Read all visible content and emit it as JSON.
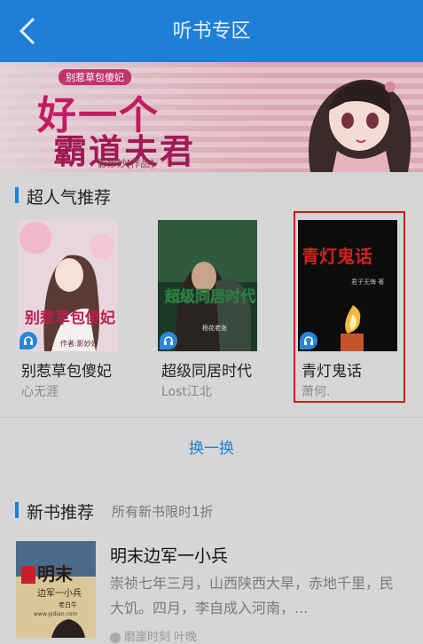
{
  "header": {
    "title": "听书专区",
    "back_icon": "back-arrow-icon"
  },
  "banner": {
    "subtitle": "别惹草包傻妃",
    "title_line1": "好一个",
    "title_line2": "霸道夫君",
    "author": "影妙妙[作品]"
  },
  "popular": {
    "section_title": "超人气推荐",
    "books": [
      {
        "title": "别惹草包傻妃",
        "author": "心无涯",
        "cover_text": "别惹草包傻妃",
        "cover_author": "作者:影妙妙"
      },
      {
        "title": "超级同居时代",
        "author": "Lost江北",
        "cover_text": "超级同居时代",
        "cover_author": "杨花老张"
      },
      {
        "title": "青灯鬼话",
        "author": "萧何.",
        "cover_text": "青灯鬼话",
        "cover_author": "君子无悔 著"
      }
    ],
    "swap_label": "换一换"
  },
  "new_books": {
    "section_title": "新书推荐",
    "section_subtitle": "所有新书限时1折",
    "book": {
      "title": "明末边军一小兵",
      "description": "崇祯七年三月，山西陕西大旱，赤地千里，民大饥。四月，李自成入河南，...",
      "meta": "磨崖时刻 叶晚",
      "cover_text": "明末",
      "cover_sub": "边军一小兵",
      "cover_author": "老白牛",
      "cover_url": "www.gidian.com"
    }
  },
  "colors": {
    "accent": "#1e7fd6",
    "selection": "#d11a1a"
  }
}
